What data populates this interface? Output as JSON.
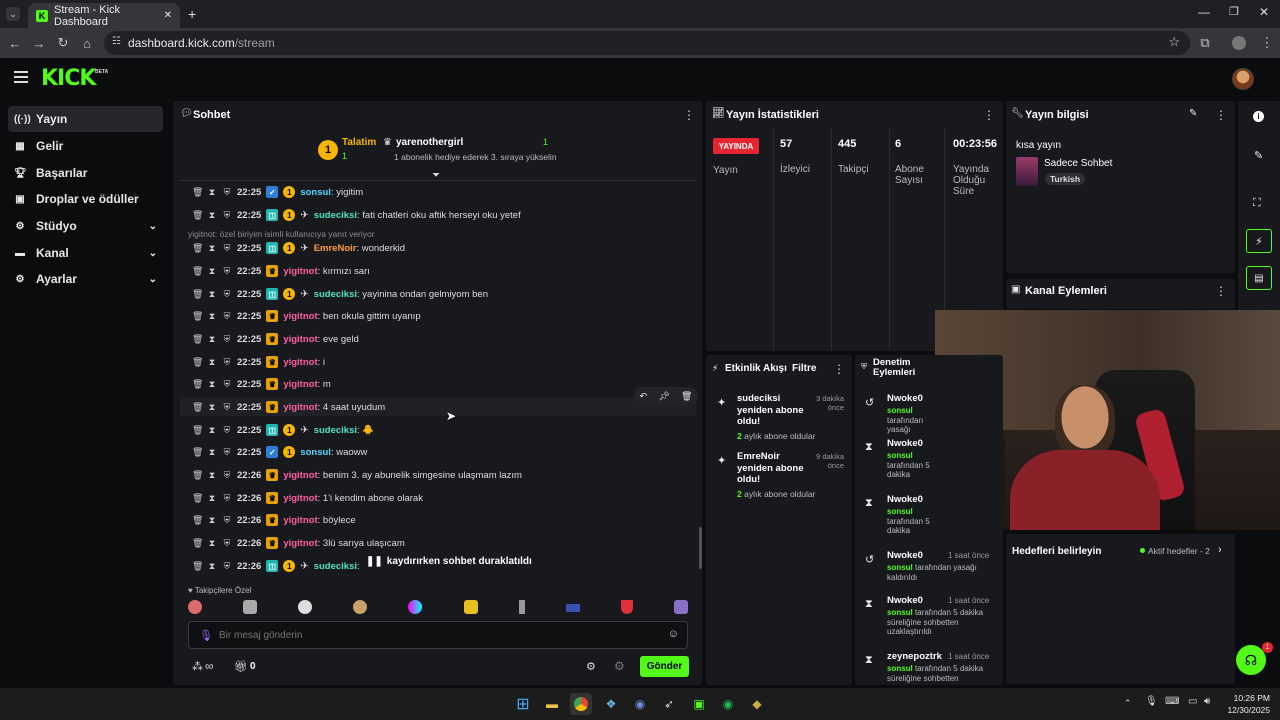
{
  "browser": {
    "tab_title": "Stream - Kick Dashboard",
    "url_host": "dashboard.kick.com",
    "url_path": "/stream"
  },
  "app": {
    "logo": "KICK",
    "beta": "BETA"
  },
  "sidebar": {
    "items": [
      {
        "label": "Yayın",
        "icon": "broadcast-icon",
        "active": true
      },
      {
        "label": "Gelir",
        "icon": "revenue-icon"
      },
      {
        "label": "Başarılar",
        "icon": "trophy-icon"
      },
      {
        "label": "Droplar ve ödüller",
        "icon": "gift-icon"
      },
      {
        "label": "Stüdyo",
        "icon": "studio-icon",
        "expand": true
      },
      {
        "label": "Kanal",
        "icon": "channel-icon",
        "expand": true
      },
      {
        "label": "Ayarlar",
        "icon": "settings-icon",
        "expand": true
      }
    ]
  },
  "chat": {
    "title": "Sohbet",
    "pinned": {
      "rank": "1",
      "name1": "Talatim",
      "count1": "1",
      "name2": "yarenothergirl",
      "count2": "1",
      "note": "1 abonelik hediye ederek 3. sıraya yükselin"
    },
    "reply_note": "yigitnot: özel biriyim isimli kullanıcıya yanıt veriyor",
    "messages": [
      {
        "time": "22:25",
        "user": "sonsul",
        "text": "yigitim",
        "color": "#53d4ff",
        "badges": [
          "blue",
          "sub"
        ]
      },
      {
        "time": "22:25",
        "user": "sudeciksi",
        "text": "fati chatleri oku aftik herseyi oku yetef",
        "color": "#4fe3c1",
        "badges": [
          "cyan",
          "sub",
          "plane"
        ]
      },
      {
        "time": "22:25",
        "user": "EmreNoir",
        "text": "wonderkid",
        "color": "#ff9d3a",
        "badges": [
          "cyan",
          "sub",
          "plane"
        ]
      },
      {
        "time": "22:25",
        "user": "yigitnot",
        "text": "kırmızı sarı",
        "color": "#ff5fa2",
        "badges": [
          "crown"
        ]
      },
      {
        "time": "22:25",
        "user": "sudeciksi",
        "text": "yayinina ondan gelmiyom ben",
        "color": "#4fe3c1",
        "badges": [
          "cyan",
          "sub",
          "plane"
        ]
      },
      {
        "time": "22:25",
        "user": "yigitnot",
        "text": "ben okula gittim uyanıp",
        "color": "#ff5fa2",
        "badges": [
          "crown"
        ]
      },
      {
        "time": "22:25",
        "user": "yigitnot",
        "text": "eve geld",
        "color": "#ff5fa2",
        "badges": [
          "crown"
        ]
      },
      {
        "time": "22:25",
        "user": "yigitnot",
        "text": "i",
        "color": "#ff5fa2",
        "badges": [
          "crown"
        ]
      },
      {
        "time": "22:25",
        "user": "yigitnot",
        "text": "m",
        "color": "#ff5fa2",
        "badges": [
          "crown"
        ]
      },
      {
        "time": "22:25",
        "user": "yigitnot",
        "text": "4 saat uyudum",
        "color": "#ff5fa2",
        "badges": [
          "crown"
        ]
      },
      {
        "time": "22:25",
        "user": "sudeciksi",
        "text": "🐥",
        "color": "#4fe3c1",
        "badges": [
          "cyan",
          "sub",
          "plane"
        ]
      },
      {
        "time": "22:25",
        "user": "sonsul",
        "text": "waoww",
        "color": "#53d4ff",
        "badges": [
          "blue",
          "sub"
        ]
      },
      {
        "time": "22:26",
        "user": "yigitnot",
        "text": "benim 3. ay abunelik simgesine ulaşmam lazım",
        "color": "#ff5fa2",
        "badges": [
          "crown"
        ]
      },
      {
        "time": "22:26",
        "user": "yigitnot",
        "text": "1'i kendim abone olarak",
        "color": "#ff5fa2",
        "badges": [
          "crown"
        ]
      },
      {
        "time": "22:26",
        "user": "yigitnot",
        "text": "böylece",
        "color": "#ff5fa2",
        "badges": [
          "crown"
        ]
      },
      {
        "time": "22:26",
        "user": "yigitnot",
        "text": "3lü sarıya ulaşıcam",
        "color": "#ff5fa2",
        "badges": [
          "crown"
        ]
      },
      {
        "time": "22:26",
        "user": "sudeciksi",
        "text": "se",
        "color": "#4fe3c1",
        "badges": [
          "cyan",
          "sub",
          "plane"
        ]
      }
    ],
    "paused": "kaydırırken sohbet duraklatıldı",
    "followers_only": "Takipçilere Özel",
    "input_placeholder": "Bir mesaj gönderin",
    "send": "Gönder",
    "infinity": "∞",
    "gift_count": "0"
  },
  "stats": {
    "title": "Yayın İstatistikleri",
    "live_badge": "YAYINDA",
    "items": [
      {
        "label": "Yayın",
        "value": ""
      },
      {
        "label": "İzleyici",
        "value": "57"
      },
      {
        "label": "Takipçi",
        "value": "445"
      },
      {
        "label": "Abone Sayısı",
        "value": "6"
      },
      {
        "label": "Yayında Olduğu Süre",
        "value": "00:23:56"
      }
    ]
  },
  "stream_info": {
    "title": "Yayın bilgisi",
    "stream_title": "kısa yayın",
    "category": "Sadece Sohbet",
    "tag": "Turkish"
  },
  "channel_actions": {
    "title": "Kanal Eylemleri"
  },
  "goals": {
    "title": "Hedefleri belirleyin",
    "active": "Aktif hedefler - 2"
  },
  "activity": {
    "title": "Etkinlik Akışı",
    "filter": "Filtre",
    "items": [
      {
        "user": "sudeciksi",
        "action": "yeniden abone oldu!",
        "detail_num": "2",
        "detail": "aylık abone oldular",
        "time": "3 dakika önce"
      },
      {
        "user": "EmreNoir",
        "action": "yeniden abone oldu!",
        "detail_num": "2",
        "detail": "aylık abone oldular",
        "time": "9 dakika önce"
      }
    ]
  },
  "moderation": {
    "title": "Denetim Eylemleri",
    "items": [
      {
        "user": "Nwoke0",
        "time": "",
        "actor": "sonsul",
        "text": "tarafından yasağı kaldırıldı",
        "icon": "undo-icon"
      },
      {
        "user": "Nwoke0",
        "time": "",
        "actor": "sonsul",
        "text": "tarafından 5 dakika süreliğine sohbetten uzaklaştırıldı",
        "icon": "hourglass-icon"
      },
      {
        "user": "Nwoke0",
        "time": "",
        "actor": "sonsul",
        "text": "tarafından 5 dakika süreliğine sohbetten uzaklaştırıldı",
        "icon": "hourglass-icon"
      },
      {
        "user": "Nwoke0",
        "time": "1 saat önce",
        "actor": "sonsul",
        "text": "tarafından yasağı kaldırıldı",
        "icon": "undo-icon"
      },
      {
        "user": "Nwoke0",
        "time": "1 saat önce",
        "actor": "sonsul",
        "text": "tarafından 5 dakika süreliğine sohbetten uzaklaştırıldı",
        "icon": "hourglass-icon"
      },
      {
        "user": "zeynepoztrk",
        "time": "1 saat önce",
        "actor": "sonsul",
        "text": "tarafından 5 dakika süreliğine sohbetten",
        "icon": "hourglass-icon"
      }
    ]
  },
  "taskbar": {
    "time": "10:26 PM",
    "date": "12/30/2025",
    "badge": "1"
  },
  "colors": {
    "accent": "#53fc18",
    "live": "#e5252f",
    "panel": "#18191d"
  }
}
